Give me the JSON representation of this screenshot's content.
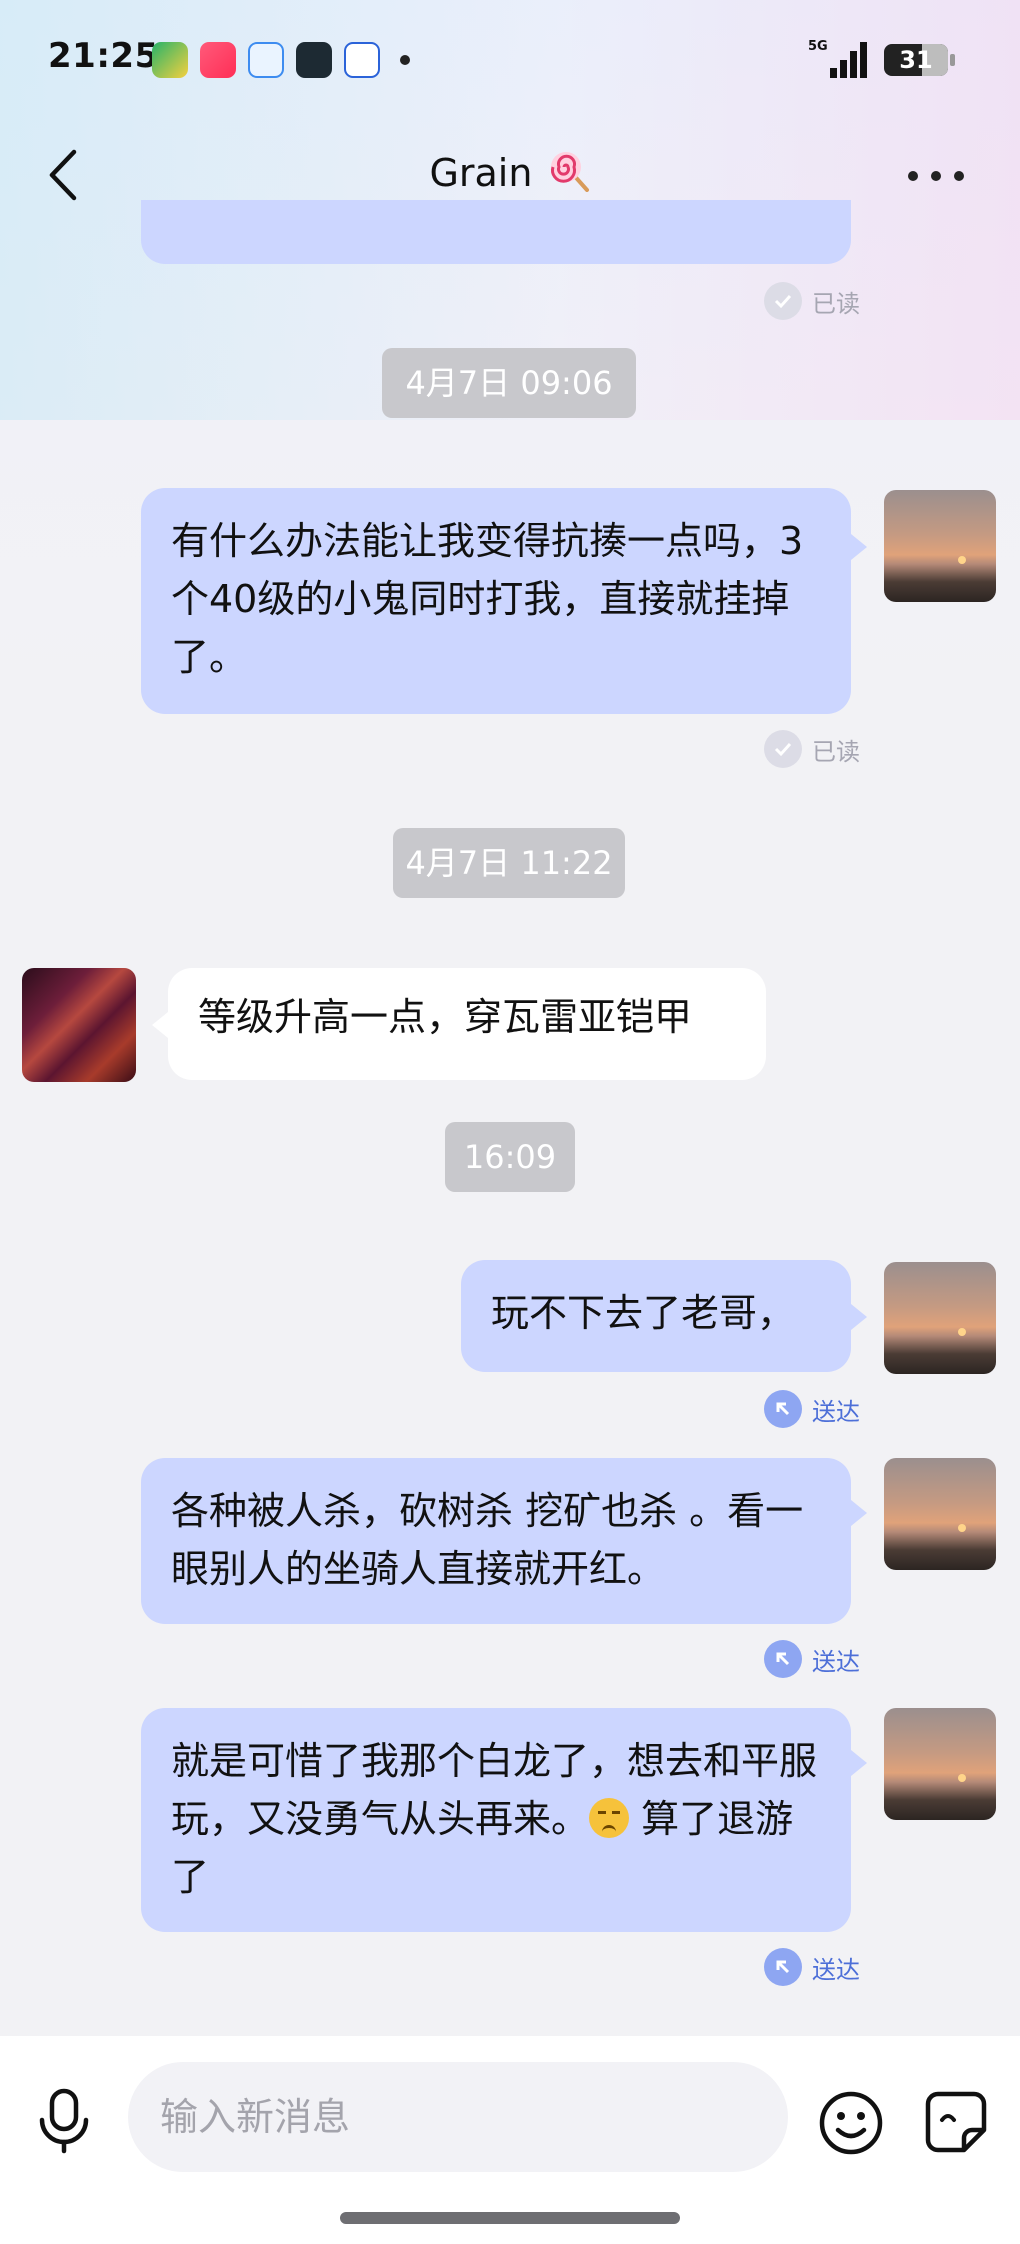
{
  "status_bar": {
    "time": "21:25",
    "network": "5G",
    "battery": "31"
  },
  "header": {
    "title": "Grain"
  },
  "messages": [
    {
      "text": "有什么办法能让我变得抗揍一点吗，3个40级的小鬼同时打我，直接就挂掉了。"
    },
    {
      "text": "等级升高一点，穿瓦雷亚铠甲"
    },
    {
      "text": "玩不下去了老哥，"
    },
    {
      "text": "各种被人杀，砍树杀 挖矿也杀 。看一眼别人的坐骑人直接就开红。"
    },
    {
      "text_a": "就是可惜了我那个白龙了，想去和平服玩，又没勇气从头再来。",
      "text_b": "算了退游了"
    }
  ],
  "timestamps": [
    "4月7日 09:06",
    "4月7日 11:22",
    "16:09"
  ],
  "receipts": {
    "read": "已读",
    "sent": "送达"
  },
  "composer": {
    "placeholder": "输入新消息"
  },
  "colors": {
    "outgoing_bubble": "#ccd6ff",
    "incoming_bubble": "#ffffff",
    "sent_accent": "#4d6fd8"
  },
  "icons": [
    "back-icon",
    "more-icon",
    "mic-icon",
    "emoji-icon",
    "sticker-icon",
    "check-icon",
    "sent-arrow-icon"
  ]
}
